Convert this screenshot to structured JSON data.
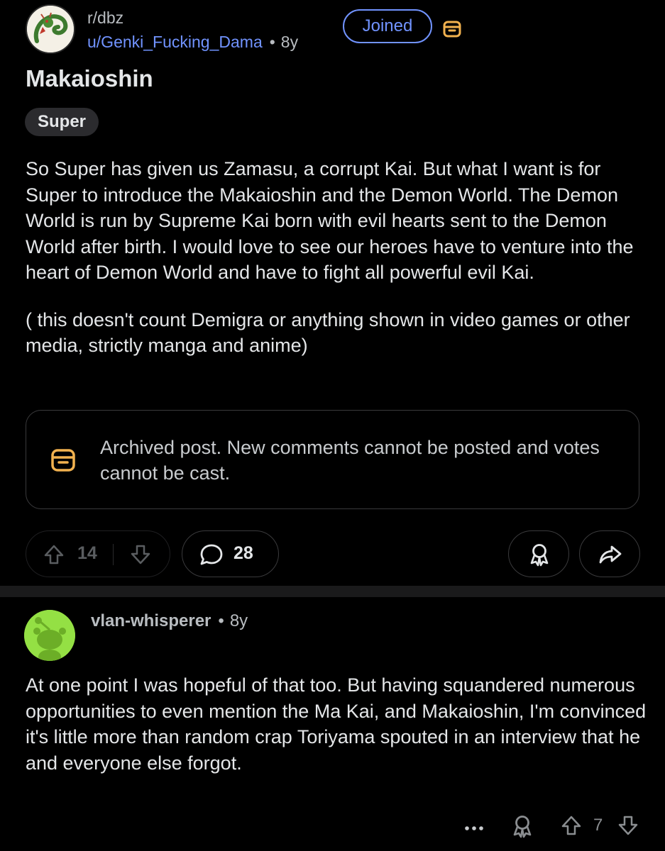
{
  "post": {
    "subreddit": "r/dbz",
    "author": "u/Genki_Fucking_Dama",
    "separator": "•",
    "age": "8y",
    "join_label": "Joined",
    "title": "Makaioshin",
    "flair": "Super",
    "body_paragraphs": [
      "So Super has given us Zamasu, a corrupt Kai. But what I want is for Super to introduce the Makaioshin and the Demon World. The Demon World is run by Supreme Kai born with evil hearts sent to the Demon World after birth. I would love to see our heroes have to venture into the heart of Demon World and have to fight all powerful evil Kai.",
      "( this doesn't count Demigra or anything shown in video games or other media, strictly manga and anime)"
    ],
    "archived_notice": "Archived post. New comments cannot be posted and votes cannot be cast.",
    "vote_count": "14",
    "comment_count": "28"
  },
  "comment": {
    "author": "vlan-whisperer",
    "separator": "•",
    "age": "8y",
    "body": "At one point I was hopeful of that too.  But having squandered numerous opportunities to even mention the Ma Kai, and Makaioshin, I'm convinced it's little more than random crap Toriyama spouted in an interview that he and everyone else forgot.",
    "vote_count": "7"
  },
  "colors": {
    "background": "#000000",
    "accent_blue": "#7193ff",
    "archive_orange": "#f2b24f",
    "avatar_green": "#94e044",
    "text": "#e4e6e8"
  },
  "icons": {
    "archive": "archive-box-icon",
    "upvote": "arrow-up-icon",
    "downvote": "arrow-down-icon",
    "comments": "speech-bubble-icon",
    "award": "award-icon",
    "share": "share-arrow-icon",
    "more": "ellipsis-icon"
  }
}
